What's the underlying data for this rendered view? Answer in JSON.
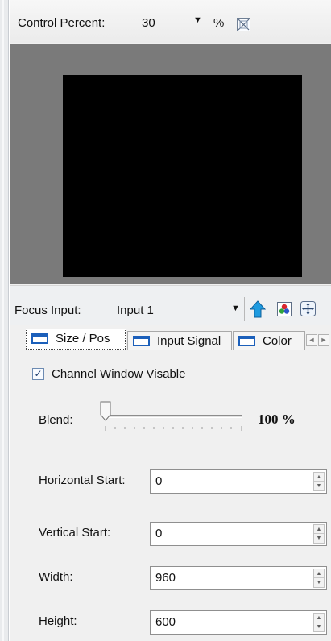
{
  "toolbar": {
    "control_percent_label": "Control Percent:",
    "control_percent_value": "30",
    "unit": "%",
    "dropdown_icon": "chevron-down-icon",
    "fit_icon": "fit-window-icon"
  },
  "focus": {
    "label": "Focus Input:",
    "value": "Input 1",
    "icons": [
      "upload-arrow-icon",
      "rgb-color-icon",
      "move-arrows-icon"
    ]
  },
  "tabs": [
    {
      "label": "Size / Pos",
      "active": true
    },
    {
      "label": "Input Signal",
      "active": false
    },
    {
      "label": "Color",
      "active": false
    }
  ],
  "tab_scroll": {
    "left": "◄",
    "right": "►"
  },
  "content": {
    "checkbox_label": "Channel Window Visable",
    "checkbox_checked": true,
    "blend_label": "Blend:",
    "blend_value": "100 %",
    "blend_level_fraction": 0.0,
    "fields": [
      {
        "label": "Horizontal Start:",
        "value": "0"
      },
      {
        "label": "Vertical Start:",
        "value": "0"
      },
      {
        "label": "Width:",
        "value": "960"
      },
      {
        "label": "Height:",
        "value": "600"
      }
    ]
  },
  "colors": {
    "preview_background": "#7a7a7a",
    "preview_screen": "#000000",
    "tab_icon_blue": "#1b5fba",
    "upload_arrow_blue": "#1e9be0"
  }
}
